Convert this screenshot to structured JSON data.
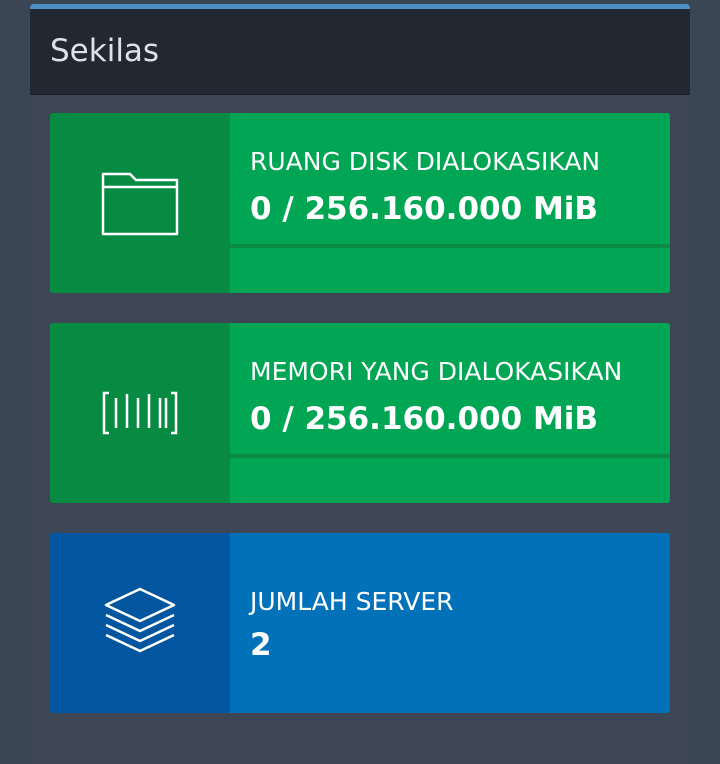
{
  "panel": {
    "title": "Sekilas"
  },
  "cards": [
    {
      "label": "RUANG DISK DIALOKASIKAN",
      "value": "0 / 256.160.000 MiB",
      "icon": "folder-icon",
      "progress": 0
    },
    {
      "label": "MEMORI YANG DIALOKASIKAN",
      "value": "0 / 256.160.000 MiB",
      "icon": "memory-icon",
      "progress": 0
    },
    {
      "label": "JUMLAH SERVER",
      "value": "2",
      "icon": "layers-icon"
    }
  ],
  "colors": {
    "accent_top": "#4d8fc4",
    "header_bg": "#212831",
    "panel_bg": "#3c4654",
    "green": "#00a653",
    "green_dark": "#078b43",
    "blue": "#0172b9",
    "blue_dark": "#0256a0"
  }
}
